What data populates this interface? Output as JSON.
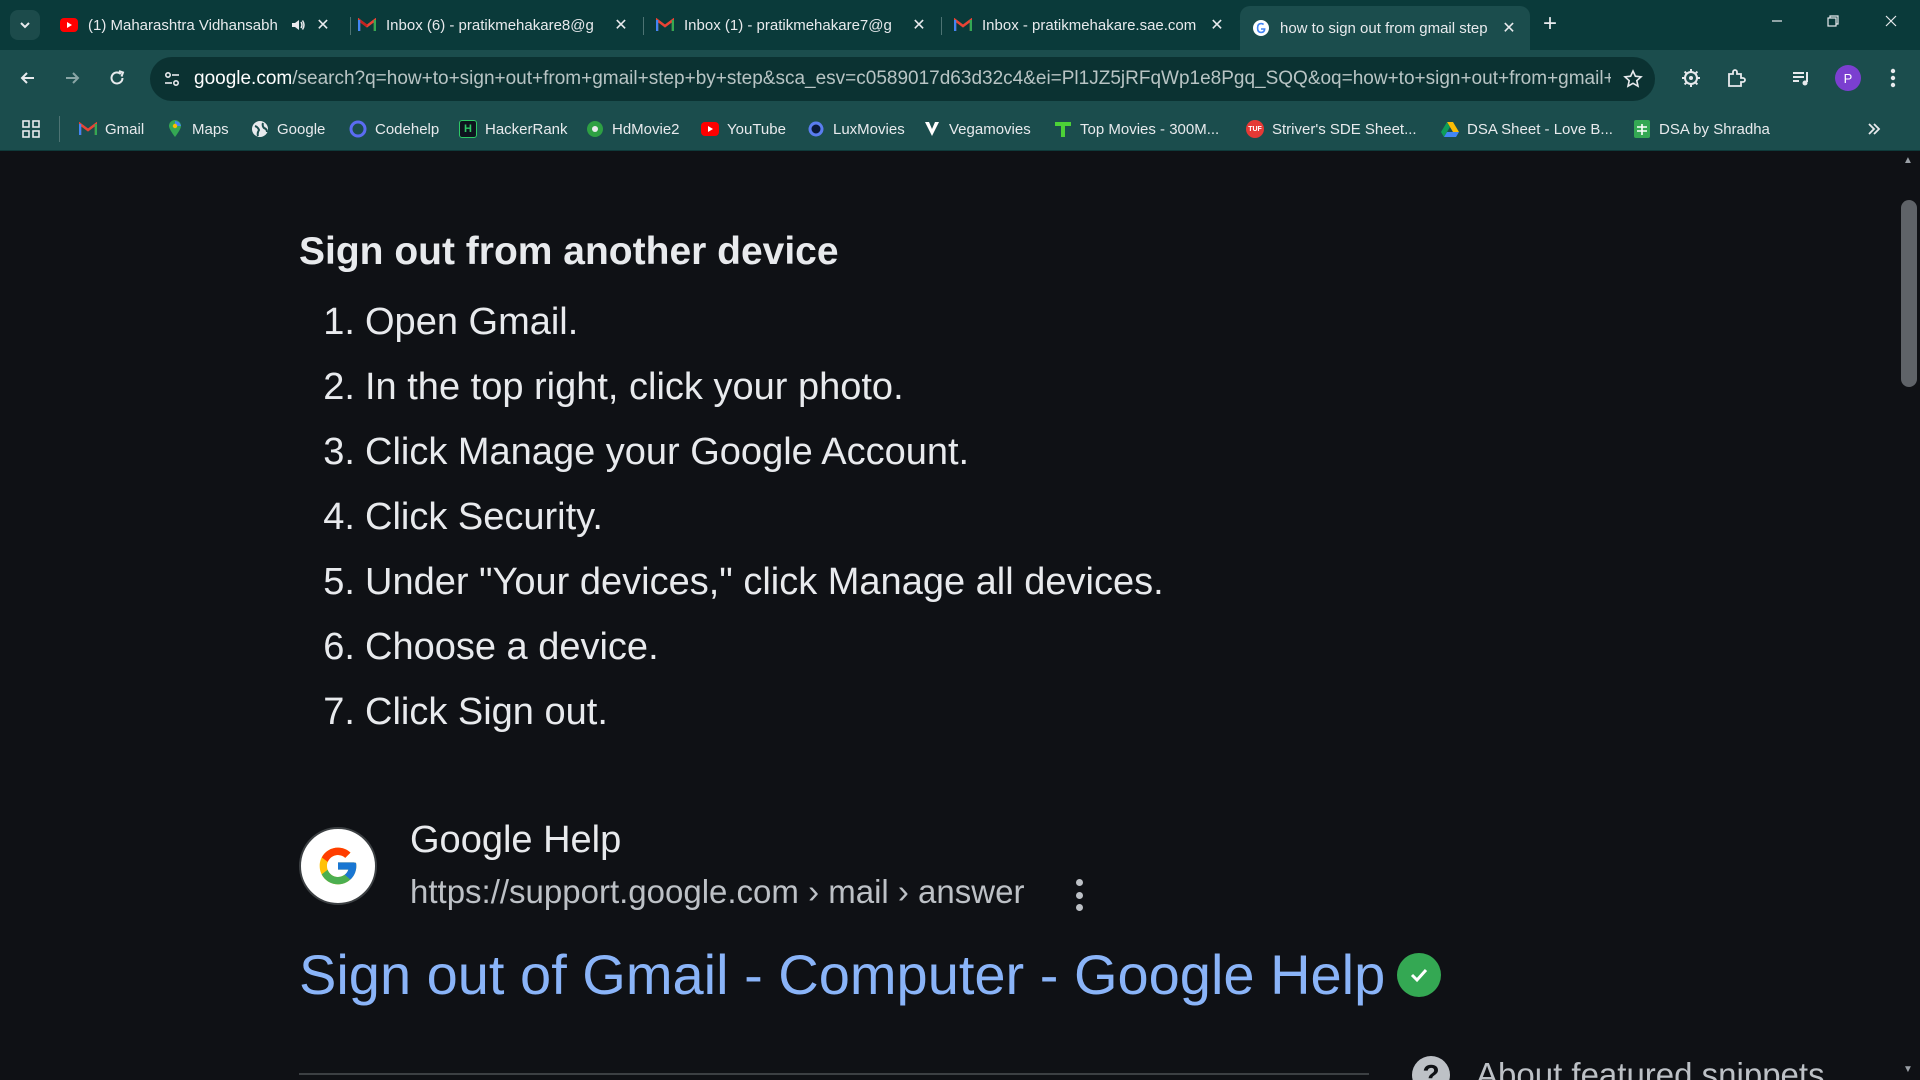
{
  "tabs": [
    {
      "title": "(1) Maharashtra Vidhansabh",
      "favicon": "youtube-icon",
      "audio": true
    },
    {
      "title": "Inbox (6) - pratikmehakare8@g",
      "favicon": "gmail-icon"
    },
    {
      "title": "Inbox (1) - pratikmehakare7@g",
      "favicon": "gmail-icon"
    },
    {
      "title": "Inbox - pratikmehakare.sae.com",
      "favicon": "gmail-icon"
    },
    {
      "title": "how to sign out from gmail step",
      "favicon": "google-icon",
      "active": true
    }
  ],
  "address_bar": {
    "host": "google.com",
    "path": "/search?q=how+to+sign+out+from+gmail+step+by+step&sca_esv=c0589017d63d32c4&ei=Pl1JZ5jRFqWp1e8Pgq_SQQ&oq=how+to+sign+out+from+gmail+steo&g..."
  },
  "profile_initial": "P",
  "bookmarks": [
    {
      "label": "Gmail",
      "icon": "gmail-icon"
    },
    {
      "label": "Maps",
      "icon": "maps-icon"
    },
    {
      "label": "Google",
      "icon": "globe-icon"
    },
    {
      "label": "Codehelp",
      "icon": "codehelp-icon"
    },
    {
      "label": "HackerRank",
      "icon": "hackerrank-icon"
    },
    {
      "label": "HdMovie2",
      "icon": "hdmovie-icon"
    },
    {
      "label": "YouTube",
      "icon": "youtube-icon"
    },
    {
      "label": "LuxMovies",
      "icon": "luxmovies-icon"
    },
    {
      "label": "Vegamovies",
      "icon": "vegamovies-icon"
    },
    {
      "label": "Top Movies - 300M...",
      "icon": "topmovies-icon"
    },
    {
      "label": "Striver's SDE Sheet...",
      "icon": "tuf-icon"
    },
    {
      "label": "DSA Sheet - Love B...",
      "icon": "drive-icon"
    },
    {
      "label": "DSA by Shradha",
      "icon": "sheets-icon"
    }
  ],
  "content": {
    "heading": "Sign out from another device",
    "steps": [
      {
        "num": "1.",
        "text": "Open Gmail."
      },
      {
        "num": "2.",
        "text": "In the top right, click your photo."
      },
      {
        "num": "3.",
        "text": "Click Manage your Google Account."
      },
      {
        "num": "4.",
        "text": "Click Security."
      },
      {
        "num": "5.",
        "text": "Under \"Your devices,\" click Manage all devices."
      },
      {
        "num": "6.",
        "text": "Choose a device."
      },
      {
        "num": "7.",
        "text": "Click Sign out."
      }
    ],
    "source_name": "Google Help",
    "source_url": "https://support.google.com › mail › answer",
    "result_title": "Sign out of Gmail - Computer - Google Help",
    "snippet_help": "About featured snippets"
  },
  "colors": {
    "tab_strip": "#0a3a3a",
    "toolbar": "#1b4d4d",
    "page_bg": "#0f1115",
    "link": "#8ab4f8",
    "verified": "#34a853"
  }
}
